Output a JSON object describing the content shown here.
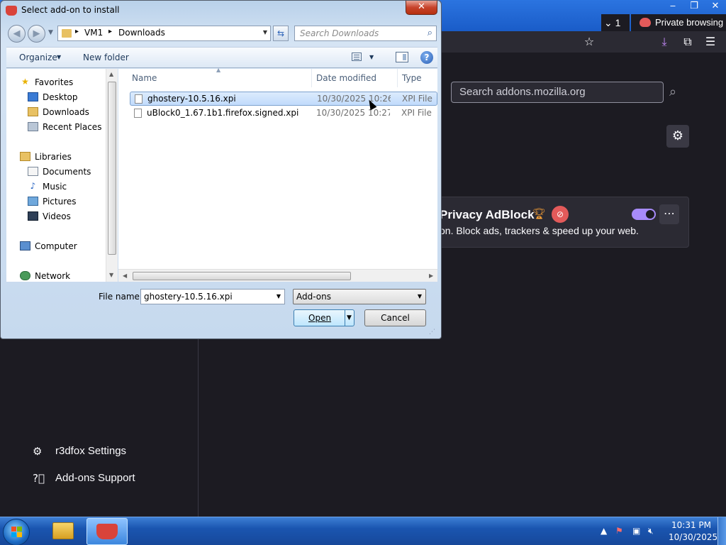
{
  "dialog": {
    "title": "Select add-on to install",
    "close_glyph": "✕",
    "path": [
      "VM1",
      "Downloads"
    ],
    "search_placeholder": "Search Downloads",
    "toolbar": {
      "organize": "Organize",
      "new_folder": "New folder"
    },
    "nav_pane": {
      "items": [
        {
          "label": "Favorites",
          "icon": "star-icon"
        },
        {
          "label": "Desktop",
          "icon": "desktop-icon"
        },
        {
          "label": "Downloads",
          "icon": "downloads-folder-icon"
        },
        {
          "label": "Recent Places",
          "icon": "recent-places-icon"
        },
        {
          "label": "Libraries",
          "icon": "libraries-icon"
        },
        {
          "label": "Documents",
          "icon": "documents-icon"
        },
        {
          "label": "Music",
          "icon": "music-icon"
        },
        {
          "label": "Pictures",
          "icon": "pictures-icon"
        },
        {
          "label": "Videos",
          "icon": "videos-icon"
        },
        {
          "label": "Computer",
          "icon": "computer-icon"
        },
        {
          "label": "Network",
          "icon": "network-icon"
        }
      ]
    },
    "columns": {
      "name": "Name",
      "date_modified": "Date modified",
      "type": "Type"
    },
    "files": [
      {
        "name": "ghostery-10.5.16.xpi",
        "date": "10/30/2025 10:26 ...",
        "type": "XPI File",
        "selected": true
      },
      {
        "name": "uBlock0_1.67.1b1.firefox.signed.xpi",
        "date": "10/30/2025 10:27 ...",
        "type": "XPI File",
        "selected": false
      }
    ],
    "filename_label": "File name:",
    "filename_value": "ghostery-10.5.16.xpi",
    "filetype_value": "Add-ons",
    "open_label": "Open",
    "cancel_label": "Cancel"
  },
  "browser": {
    "tab_count": "1",
    "private_label": "Private browsing",
    "addons_search_placeholder": "Search addons.mozilla.org",
    "addon": {
      "name": "Privacy AdBlock",
      "description": "on. Block ads, trackers & speed up your web.",
      "enabled": true
    },
    "sidebar_links": [
      {
        "label": "r3dfox Settings",
        "icon": "gear-icon"
      },
      {
        "label": "Add-ons Support",
        "icon": "help-circle-icon"
      }
    ]
  },
  "taskbar": {
    "time": "10:31 PM",
    "date": "10/30/2025"
  }
}
